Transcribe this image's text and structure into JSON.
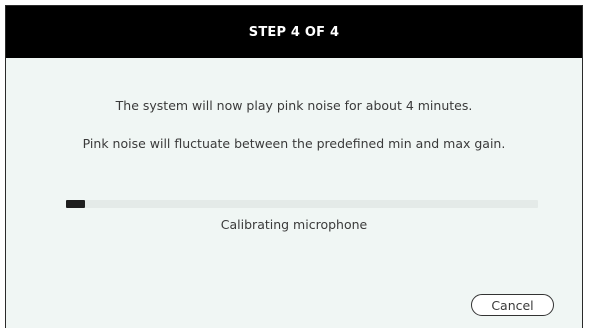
{
  "dialog": {
    "title": "STEP 4 OF 4",
    "message_line1": "The system will now play pink noise for about 4 minutes.",
    "message_line2": "Pink noise will fluctuate between the predefined min and max gain.",
    "progress": {
      "label": "Calibrating microphone",
      "fraction": 0.04
    },
    "cancel_label": "Cancel"
  },
  "colors": {
    "header_bg": "#000000",
    "header_text": "#ffffff",
    "body_bg": "#f0f6f4",
    "progress_fill": "#1e1e1e",
    "progress_track": "#e4eae8"
  }
}
